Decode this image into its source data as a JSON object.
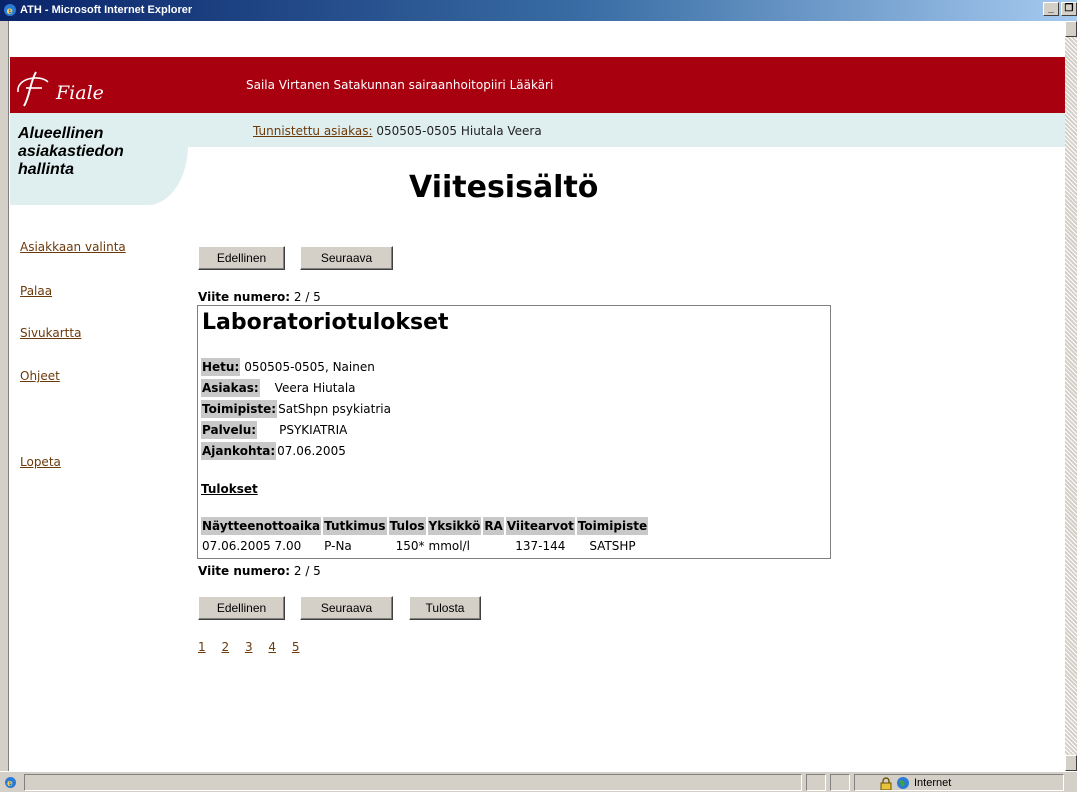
{
  "window": {
    "title": "ATH - Microsoft Internet Explorer",
    "min": "_",
    "restore": "❐"
  },
  "header": {
    "logo_text": "Fiale",
    "user_line": "Saila Virtanen Satakunnan sairaanhoitopiiri Lääkäri",
    "brand": [
      "Alueellinen",
      "asiakastiedon",
      "hallinta"
    ],
    "client_label": "Tunnistettu asiakas:",
    "client_value": "050505-0505 Hiutala Veera"
  },
  "page_title": "Viitesisältö",
  "nav": [
    "Asiakkaan valinta",
    "Palaa",
    "Sivukartta",
    "Ohjeet",
    "Lopeta"
  ],
  "buttons": {
    "prev": "Edellinen",
    "next": "Seuraava",
    "print": "Tulosta"
  },
  "viite": {
    "label": "Viite numero:",
    "value": "2 / 5"
  },
  "card": {
    "title": "Laboratoriotulokset",
    "info": [
      {
        "key": "Hetu:",
        "value": "050505-0505, Nainen"
      },
      {
        "key": "Asiakas:",
        "value": "Veera Hiutala"
      },
      {
        "key": "Toimipiste:",
        "value": "SatShpn psykiatria"
      },
      {
        "key": "Palvelu:",
        "value": "PSYKIATRIA"
      },
      {
        "key": "Ajankohta:",
        "value": "07.06.2005"
      }
    ],
    "results_heading": "Tulokset",
    "columns": [
      "Näytteenottoaika",
      "Tutkimus",
      "Tulos",
      "Yksikkö",
      "RA",
      "Viitearvot",
      "Toimipiste"
    ],
    "rows": [
      [
        "07.06.2005 7.00",
        "P-Na",
        "150*",
        "mmol/l",
        "",
        "137-144",
        "SATSHP"
      ]
    ]
  },
  "pager": [
    "1",
    "2",
    "3",
    "4",
    "5"
  ],
  "status": {
    "zone": "Internet"
  },
  "colors": {
    "header_red": "#a8000f",
    "header_light": "#dfeff0",
    "link": "#6b3a0b"
  }
}
